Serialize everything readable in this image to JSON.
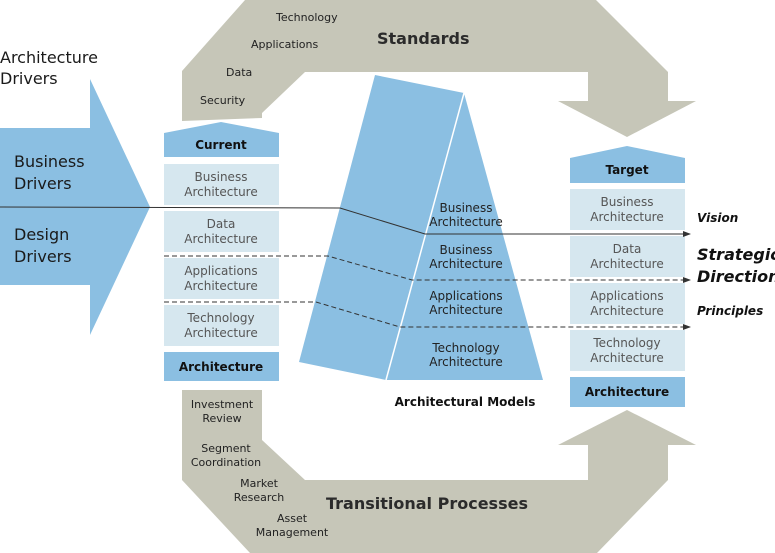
{
  "colors": {
    "gray_arrow": "#c6c6b8",
    "blue_dark": "#8bbfe2",
    "blue_light": "#d6e7ef",
    "line": "#333333"
  },
  "drivers": {
    "title_line1": "Architecture",
    "title_line2": "Drivers",
    "business_line1": "Business",
    "business_line2": "Drivers",
    "design_line1": "Design",
    "design_line2": "Drivers"
  },
  "standards": {
    "title": "Standards",
    "items": [
      "Technology",
      "Applications",
      "Data",
      "Security"
    ]
  },
  "current": {
    "header": "Current",
    "boxes": [
      {
        "line1": "Business",
        "line2": "Architecture"
      },
      {
        "line1": "Data",
        "line2": "Architecture"
      },
      {
        "line1": "Applications",
        "line2": "Architecture"
      },
      {
        "line1": "Technology",
        "line2": "Architecture"
      }
    ],
    "footer": "Architecture"
  },
  "models": {
    "title": "Architectural Models",
    "layers": [
      {
        "line1": "Business",
        "line2": "Architecture"
      },
      {
        "line1": "Business",
        "line2": "Architecture"
      },
      {
        "line1": "Applications",
        "line2": "Architecture"
      },
      {
        "line1": "Technology",
        "line2": "Architecture"
      }
    ]
  },
  "target": {
    "header": "Target",
    "boxes": [
      {
        "line1": "Business",
        "line2": "Architecture"
      },
      {
        "line1": "Data",
        "line2": "Architecture"
      },
      {
        "line1": "Applications",
        "line2": "Architecture"
      },
      {
        "line1": "Technology",
        "line2": "Architecture"
      }
    ],
    "footer": "Architecture"
  },
  "direction": {
    "vision": "Vision",
    "strategic_line1": "Strategic",
    "strategic_line2": "Direction",
    "principles": "Principles"
  },
  "transitional": {
    "title": "Transitional Processes",
    "items": [
      {
        "line1": "Investment",
        "line2": "Review"
      },
      {
        "line1": "Segment",
        "line2": "Coordination"
      },
      {
        "line1": "Market",
        "line2": "Research"
      },
      {
        "line1": "Asset",
        "line2": "Management"
      }
    ]
  }
}
